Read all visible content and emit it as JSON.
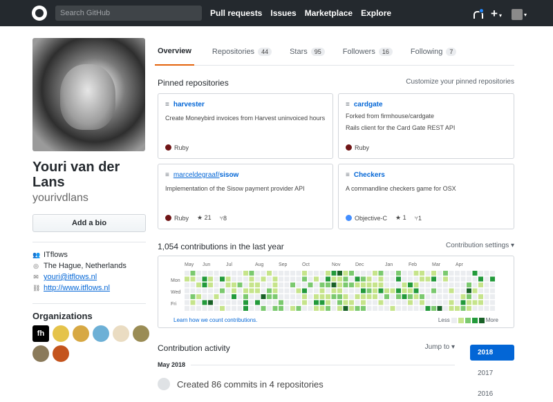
{
  "header": {
    "search_placeholder": "Search GitHub",
    "nav": [
      "Pull requests",
      "Issues",
      "Marketplace",
      "Explore"
    ],
    "plus": "+",
    "caret": "▾"
  },
  "profile": {
    "name": "Youri van der Lans",
    "login": "yourivdlans",
    "add_bio": "Add a bio",
    "company": "ITflows",
    "location": "The Hague, Netherlands",
    "email": "youri@itflows.nl",
    "website": "http://www.itflows.nl",
    "orgs_title": "Organizations",
    "org_badge": "fh"
  },
  "tabs": [
    {
      "label": "Overview",
      "count": ""
    },
    {
      "label": "Repositories",
      "count": "44"
    },
    {
      "label": "Stars",
      "count": "95"
    },
    {
      "label": "Followers",
      "count": "16"
    },
    {
      "label": "Following",
      "count": "7"
    }
  ],
  "pinned": {
    "title": "Pinned repositories",
    "customize": "Customize your pinned repositories",
    "repos": [
      {
        "owner": "",
        "name": "harvester",
        "fork": "",
        "desc": "Create Moneybird invoices from Harvest uninvoiced hours",
        "lang": "Ruby",
        "lang_color": "#701516",
        "stars": "",
        "forks": ""
      },
      {
        "owner": "",
        "name": "cardgate",
        "fork": "Forked from firmhouse/cardgate",
        "desc": "Rails client for the Card Gate REST API",
        "lang": "Ruby",
        "lang_color": "#701516",
        "stars": "",
        "forks": ""
      },
      {
        "owner": "marceldegraaf/",
        "name": "sisow",
        "fork": "",
        "desc": "Implementation of the Sisow payment provider API",
        "lang": "Ruby",
        "lang_color": "#701516",
        "stars": "21",
        "forks": "8"
      },
      {
        "owner": "",
        "name": "Checkers",
        "fork": "",
        "desc": "A commandline checkers game for OSX",
        "lang": "Objective-C",
        "lang_color": "#438eff",
        "stars": "1",
        "forks": "1"
      }
    ]
  },
  "contributions": {
    "title": "1,054 contributions in the last year",
    "settings": "Contribution settings ▾",
    "months": [
      "May",
      "Jun",
      "Jul",
      "Aug",
      "Sep",
      "Oct",
      "Nov",
      "Dec",
      "Jan",
      "Feb",
      "Mar",
      "Apr"
    ],
    "days": [
      "Mon",
      "Wed",
      "Fri"
    ],
    "learn": "Learn how we count contributions.",
    "less": "Less",
    "more": "More",
    "colors": [
      "#ebedf0",
      "#c6e48b",
      "#7bc96f",
      "#239a3b",
      "#196127"
    ]
  },
  "activity": {
    "title": "Contribution activity",
    "jump": "Jump to ▾",
    "month": "May 2018",
    "summary": "Created 86 commits in 4 repositories",
    "years": [
      "2018",
      "2017",
      "2016"
    ]
  }
}
